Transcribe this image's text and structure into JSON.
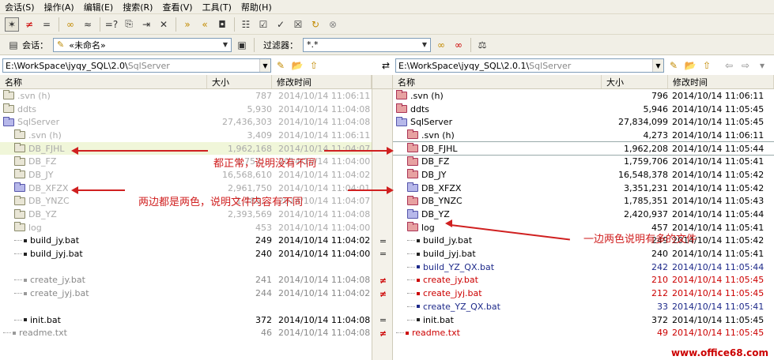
{
  "menu": [
    "会话(S)",
    "操作(A)",
    "编辑(E)",
    "搜索(R)",
    "查看(V)",
    "工具(T)",
    "帮助(H)"
  ],
  "toolbar2": {
    "session_label": "会话：",
    "session_value": "«未命名»",
    "filter_label": "过滤器：",
    "filter_value": "*.*"
  },
  "left_path": {
    "value": "E:\\WorkSpace\\jyqy_SQL\\2.0\\",
    "dim": "SqlServer"
  },
  "right_path": {
    "value": "E:\\WorkSpace\\jyqy_SQL\\2.0.1\\",
    "dim": "SqlServer"
  },
  "columns": {
    "name": "名称",
    "size": "大小",
    "modified": "修改时间"
  },
  "left_rows": [
    {
      "name": ".svn (h)",
      "size": "787",
      "date": "2014/10/14 11:06:11",
      "kind": "folder",
      "color": "plain",
      "indent": 0,
      "style": "dim"
    },
    {
      "name": "ddts",
      "size": "5,930",
      "date": "2014/10/14 11:04:08",
      "kind": "folder",
      "color": "plain",
      "indent": 0,
      "style": "dim"
    },
    {
      "name": "SqlServer",
      "size": "27,436,303",
      "date": "2014/10/14 11:04:08",
      "kind": "folder",
      "color": "open",
      "indent": 0,
      "style": "dim"
    },
    {
      "name": ".svn (h)",
      "size": "3,409",
      "date": "2014/10/14 11:06:11",
      "kind": "folder",
      "color": "plain",
      "indent": 1,
      "style": "dim"
    },
    {
      "name": "DB_FJHL",
      "size": "1,962,168",
      "date": "2014/10/14 11:04:07",
      "kind": "folder",
      "color": "plain",
      "indent": 1,
      "style": "hl"
    },
    {
      "name": "DB_FZ",
      "size": "1,757,...",
      "date": "2014/10/14 11:04:00",
      "kind": "folder",
      "color": "plain",
      "indent": 1,
      "style": "dim"
    },
    {
      "name": "DB_JY",
      "size": "16,568,610",
      "date": "2014/10/14 11:04:02",
      "kind": "folder",
      "color": "plain",
      "indent": 1,
      "style": "dim"
    },
    {
      "name": "DB_XFZX",
      "size": "2,961,750",
      "date": "2014/10/14 11:04:01",
      "kind": "folder",
      "color": "purple",
      "indent": 1,
      "style": "dim"
    },
    {
      "name": "DB_YNZC",
      "size": "1,785,...",
      "date": "2014/10/14 11:04:07",
      "kind": "folder",
      "color": "plain",
      "indent": 1,
      "style": "dim"
    },
    {
      "name": "DB_YZ",
      "size": "2,393,569",
      "date": "2014/10/14 11:04:08",
      "kind": "folder",
      "color": "plain",
      "indent": 1,
      "style": "dim"
    },
    {
      "name": "log",
      "size": "453",
      "date": "2014/10/14 11:04:00",
      "kind": "folder",
      "color": "plain",
      "indent": 1,
      "style": "dim"
    },
    {
      "name": "build_jy.bat",
      "size": "249",
      "date": "2014/10/14 11:04:02",
      "kind": "file",
      "color": "plain",
      "indent": 1,
      "style": "plain"
    },
    {
      "name": "build_jyj.bat",
      "size": "240",
      "date": "2014/10/14 11:04:00",
      "kind": "file",
      "color": "plain",
      "indent": 1,
      "style": "plain"
    },
    {
      "name": "",
      "size": "",
      "date": "",
      "kind": "empty",
      "color": "plain",
      "indent": 1,
      "style": "plain"
    },
    {
      "name": "create_jy.bat",
      "size": "241",
      "date": "2014/10/14 11:04:08",
      "kind": "file",
      "color": "plain",
      "indent": 1,
      "style": "greyt"
    },
    {
      "name": "create_jyj.bat",
      "size": "244",
      "date": "2014/10/14 11:04:02",
      "kind": "file",
      "color": "plain",
      "indent": 1,
      "style": "greyt"
    },
    {
      "name": "",
      "size": "",
      "date": "",
      "kind": "empty",
      "color": "plain",
      "indent": 1,
      "style": "plain"
    },
    {
      "name": "init.bat",
      "size": "372",
      "date": "2014/10/14 11:04:08",
      "kind": "file",
      "color": "plain",
      "indent": 1,
      "style": "plain"
    },
    {
      "name": "readme.txt",
      "size": "46",
      "date": "2014/10/14 11:04:08",
      "kind": "file",
      "color": "plain",
      "indent": 0,
      "style": "greyt"
    }
  ],
  "right_rows": [
    {
      "name": ".svn (h)",
      "size": "796",
      "date": "2014/10/14 11:06:11",
      "kind": "folder",
      "color": "red",
      "indent": 0,
      "style": "plain"
    },
    {
      "name": "ddts",
      "size": "5,946",
      "date": "2014/10/14 11:05:45",
      "kind": "folder",
      "color": "red",
      "indent": 0,
      "style": "plain"
    },
    {
      "name": "SqlServer",
      "size": "27,834,099",
      "date": "2014/10/14 11:05:45",
      "kind": "folder",
      "color": "open",
      "indent": 0,
      "style": "plain"
    },
    {
      "name": ".svn (h)",
      "size": "4,273",
      "date": "2014/10/14 11:06:11",
      "kind": "folder",
      "color": "red",
      "indent": 1,
      "style": "plain"
    },
    {
      "name": "DB_FJHL",
      "size": "1,962,208",
      "date": "2014/10/14 11:05:44",
      "kind": "folder",
      "color": "red",
      "indent": 1,
      "style": "hlbox"
    },
    {
      "name": "DB_FZ",
      "size": "1,759,706",
      "date": "2014/10/14 11:05:41",
      "kind": "folder",
      "color": "red",
      "indent": 1,
      "style": "plain"
    },
    {
      "name": "DB_JY",
      "size": "16,548,378",
      "date": "2014/10/14 11:05:42",
      "kind": "folder",
      "color": "red",
      "indent": 1,
      "style": "plain"
    },
    {
      "name": "DB_XFZX",
      "size": "3,351,231",
      "date": "2014/10/14 11:05:42",
      "kind": "folder",
      "color": "purple",
      "indent": 1,
      "style": "plain"
    },
    {
      "name": "DB_YNZC",
      "size": "1,785,351",
      "date": "2014/10/14 11:05:43",
      "kind": "folder",
      "color": "red",
      "indent": 1,
      "style": "plain"
    },
    {
      "name": "DB_YZ",
      "size": "2,420,937",
      "date": "2014/10/14 11:05:44",
      "kind": "folder",
      "color": "purple",
      "indent": 1,
      "style": "plain"
    },
    {
      "name": "log",
      "size": "457",
      "date": "2014/10/14 11:05:41",
      "kind": "folder",
      "color": "red",
      "indent": 1,
      "style": "plain"
    },
    {
      "name": "build_jy.bat",
      "size": "249",
      "date": "2014/10/14 11:05:42",
      "kind": "file",
      "color": "plain",
      "indent": 1,
      "style": "plain"
    },
    {
      "name": "build_jyj.bat",
      "size": "240",
      "date": "2014/10/14 11:05:41",
      "kind": "file",
      "color": "plain",
      "indent": 1,
      "style": "plain"
    },
    {
      "name": "build_YZ_QX.bat",
      "size": "242",
      "date": "2014/10/14 11:05:44",
      "kind": "file",
      "color": "plain",
      "indent": 1,
      "style": "purple"
    },
    {
      "name": "create_jy.bat",
      "size": "210",
      "date": "2014/10/14 11:05:45",
      "kind": "file",
      "color": "plain",
      "indent": 1,
      "style": "redt"
    },
    {
      "name": "create_jyj.bat",
      "size": "212",
      "date": "2014/10/14 11:05:45",
      "kind": "file",
      "color": "plain",
      "indent": 1,
      "style": "redt"
    },
    {
      "name": "create_YZ_QX.bat",
      "size": "33",
      "date": "2014/10/14 11:05:41",
      "kind": "file",
      "color": "plain",
      "indent": 1,
      "style": "purple"
    },
    {
      "name": "init.bat",
      "size": "372",
      "date": "2014/10/14 11:05:45",
      "kind": "file",
      "color": "plain",
      "indent": 1,
      "style": "plain"
    },
    {
      "name": "readme.txt",
      "size": "49",
      "date": "2014/10/14 11:05:45",
      "kind": "file",
      "color": "plain",
      "indent": 0,
      "style": "redt"
    }
  ],
  "marks": [
    "",
    "",
    "",
    "",
    "",
    "",
    "",
    "",
    "",
    "",
    "",
    "=",
    "=",
    "",
    "≠",
    "≠",
    "",
    "=",
    "≠"
  ],
  "annotations": {
    "a1": "都正常，说明没有不同",
    "a2": "两边都是两色，说明文件内容有不同",
    "a3": "一边两色说明有多的文件"
  },
  "watermark": "www.office68.com"
}
